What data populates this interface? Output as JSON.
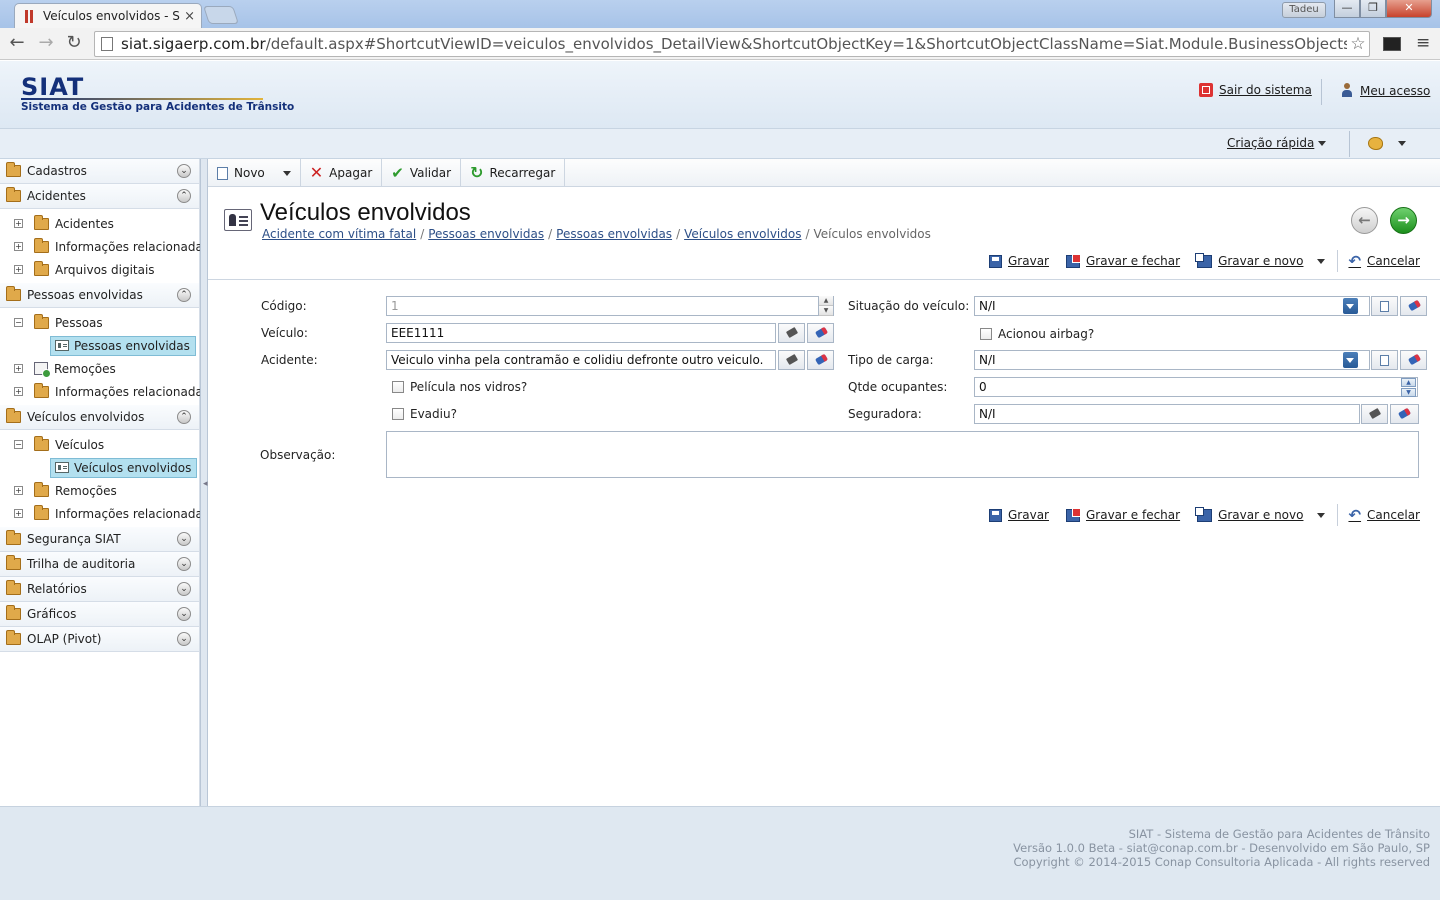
{
  "browser": {
    "tab_title": "Veículos envolvidos - SIAT",
    "tab_close": "×",
    "user_badge": "Tadeu",
    "url_host": "siat.sigaerp.com.br",
    "url_path": "/default.aspx#ShortcutViewID=veiculos_envolvidos_DetailView&ShortcutObjectKey=1&ShortcutObjectClassName=Siat.Module.BusinessObjects.siat.veiculos",
    "back_glyph": "←",
    "forward_glyph": "→",
    "reload_glyph": "↻",
    "star_glyph": "☆",
    "menu_glyph": "≡",
    "window_buttons": {
      "min": "—",
      "max": "❐",
      "close": "✕"
    }
  },
  "header": {
    "logo": "SIAT",
    "logo_subtitle": "Sistema de Gestão para Acidentes de Trânsito",
    "logout_label": "Sair do sistema",
    "account_label": "Meu acesso",
    "quick_create_label": "Criação rápida"
  },
  "sidebar": {
    "groups": {
      "cadastros": {
        "label": "Cadastros",
        "toggle": "⌄"
      },
      "acidentes": {
        "label": "Acidentes",
        "toggle": "⌃",
        "items": [
          "Acidentes",
          "Informações relacionadas",
          "Arquivos digitais"
        ]
      },
      "pessoas": {
        "label": "Pessoas envolvidas",
        "toggle": "⌃",
        "pessoas_label": "Pessoas",
        "pessoas_child": "Pessoas envolvidas",
        "remocoes": "Remoções",
        "info": "Informações relacionadas"
      },
      "veiculos": {
        "label": "Veículos envolvidos",
        "toggle": "⌃",
        "veiculos_label": "Veículos",
        "veiculos_child": "Veículos envolvidos",
        "remocoes": "Remoções",
        "info": "Informações relacionadas"
      },
      "seguranca": {
        "label": "Segurança SIAT",
        "toggle": "⌄"
      },
      "trilha": {
        "label": "Trilha de auditoria",
        "toggle": "⌄"
      },
      "relatorios": {
        "label": "Relatórios",
        "toggle": "⌄"
      },
      "graficos": {
        "label": "Gráficos",
        "toggle": "⌄"
      },
      "olap": {
        "label": "OLAP (Pivot)",
        "toggle": "⌄"
      }
    },
    "expand_glyph": "+",
    "collapse_glyph": "−"
  },
  "actions": {
    "new_label": "Novo",
    "delete_label": "Apagar",
    "validate_label": "Validar",
    "reload_label": "Recarregar"
  },
  "page": {
    "title": "Veículos envolvidos",
    "breadcrumbs": [
      "Acidente com vítima fatal",
      "Pessoas envolvidas",
      "Pessoas envolvidas",
      "Veículos envolvidos"
    ],
    "breadcrumb_current": "Veículos envolvidos",
    "breadcrumb_sep": "/"
  },
  "save_bar": {
    "save": "Gravar",
    "save_close": "Gravar e fechar",
    "save_new": "Gravar e novo",
    "cancel": "Cancelar"
  },
  "form": {
    "codigo_label": "Código:",
    "codigo_value": "1",
    "veiculo_label": "Veículo:",
    "veiculo_value": "EEE1111",
    "acidente_label": "Acidente:",
    "acidente_value": "Veiculo vinha pela contramão e colidiu defronte outro veiculo.",
    "pelicula_label": "Película nos vidros?",
    "evadiu_label": "Evadiu?",
    "situacao_label": "Situação do veículo:",
    "situacao_value": "N/I",
    "airbag_label": "Acionou airbag?",
    "carga_label": "Tipo de carga:",
    "carga_value": "N/I",
    "ocupantes_label": "Qtde ocupantes:",
    "ocupantes_value": "0",
    "seguradora_label": "Seguradora:",
    "seguradora_value": "N/I",
    "observacao_label": "Observação:",
    "spin_up": "▲",
    "spin_down": "▼"
  },
  "footer": {
    "line1": "SIAT - Sistema de Gestão para Acidentes de Trânsito",
    "line2": "Versão 1.0.0 Beta - siat@conap.com.br - Desenvolvido em São Paulo, SP",
    "line3": "Copyright © 2014-2015 Conap Consultoria Aplicada - All rights reserved"
  }
}
